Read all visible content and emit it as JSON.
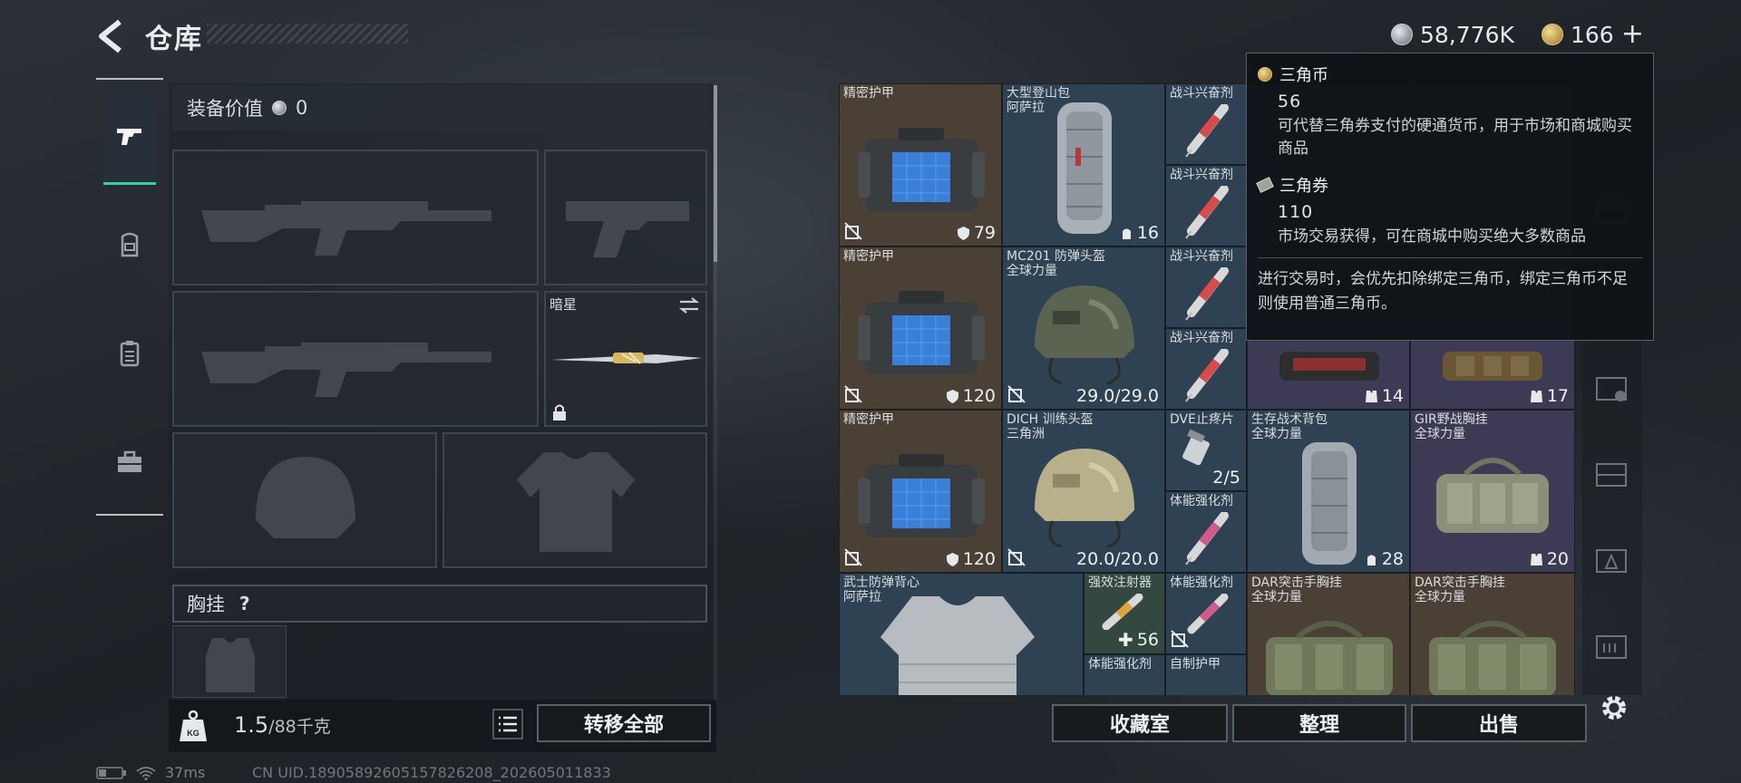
{
  "header": {
    "title": "仓库",
    "silver_amount": "58,776K",
    "gold_amount": "166",
    "plus_label": "+"
  },
  "left_panel": {
    "equipment_value_label": "装备价值",
    "equipment_value": "0",
    "melee_slot_label": "暗星",
    "chest_rig_label": "胸挂",
    "chest_rig_help": "?",
    "weight_current": "1.5",
    "weight_max": "/88千克",
    "transfer_all_label": "转移全部"
  },
  "category_tabs": [
    {
      "icon": "pistol-icon",
      "active": true
    },
    {
      "icon": "backpack-icon",
      "active": false
    },
    {
      "icon": "clipboard-icon",
      "active": false
    },
    {
      "icon": "toolbox-icon",
      "active": false
    }
  ],
  "items": {
    "precision_armor_1": {
      "name": "精密护甲",
      "count": "79"
    },
    "backpack_large": {
      "name": "大型登山包",
      "sub": "阿萨拉",
      "count": "16"
    },
    "stim_1": {
      "name": "战斗兴奋剂"
    },
    "stim_2": {
      "name": "战斗兴奋剂"
    },
    "precision_armor_2": {
      "name": "精密护甲",
      "count": "120"
    },
    "helmet_mc201": {
      "name": "MC201 防弹头盔",
      "sub": "全球力量",
      "count": "29.0/29.0"
    },
    "stim_3": {
      "name": "战斗兴奋剂"
    },
    "stim_4": {
      "name": "战斗兴奋剂"
    },
    "hidden_item_r2c5": {
      "count": "14"
    },
    "hidden_item_r2c6": {
      "count": "17"
    },
    "precision_armor_3": {
      "name": "精密护甲",
      "count": "120"
    },
    "helmet_dich": {
      "name": "DICH 训练头盔",
      "sub": "三角洲",
      "count": "20.0/20.0"
    },
    "painkiller": {
      "name": "DVE止疼片",
      "count": "2/5"
    },
    "stamina_1": {
      "name": "体能强化剂"
    },
    "survival_pack": {
      "name": "生存战术背包",
      "sub": "全球力量",
      "count": "28"
    },
    "gir_rig": {
      "name": "GIR野战胸挂",
      "sub": "全球力量",
      "count": "20"
    },
    "samurai_vest": {
      "name": "武士防弹背心",
      "sub": "阿萨拉"
    },
    "strong_injector": {
      "name": "强效注射器",
      "count": "56"
    },
    "stamina_2": {
      "name": "体能强化剂"
    },
    "stamina_3": {
      "name": "体能强化剂"
    },
    "homemade_armor": {
      "name": "自制护甲"
    },
    "dar_rig_1": {
      "name": "DAR突击手胸挂",
      "sub": "全球力量"
    },
    "dar_rig_2": {
      "name": "DAR突击手胸挂",
      "sub": "全球力量"
    }
  },
  "actions": {
    "collection_label": "收藏室",
    "sort_label": "整理",
    "sell_label": "出售"
  },
  "tooltip": {
    "coin_title": "三角币",
    "coin_value": "56",
    "coin_desc": "可代替三角券支付的硬通货币，用于市场和商城购买商品",
    "ticket_title": "三角券",
    "ticket_value": "110",
    "ticket_desc": "市场交易获得，可在商城中购买绝大多数商品",
    "note": "进行交易时，会优先扣除绑定三角币，绑定三角币不足则使用普通三角币。"
  },
  "status": {
    "ping": "37ms",
    "uid": "CN UID.18905892605157826208_202605011833"
  },
  "colors": {
    "accent_green": "#35d29e",
    "item_brown": "#4a4036",
    "item_blue": "#2f4253",
    "item_green": "#33483f"
  }
}
